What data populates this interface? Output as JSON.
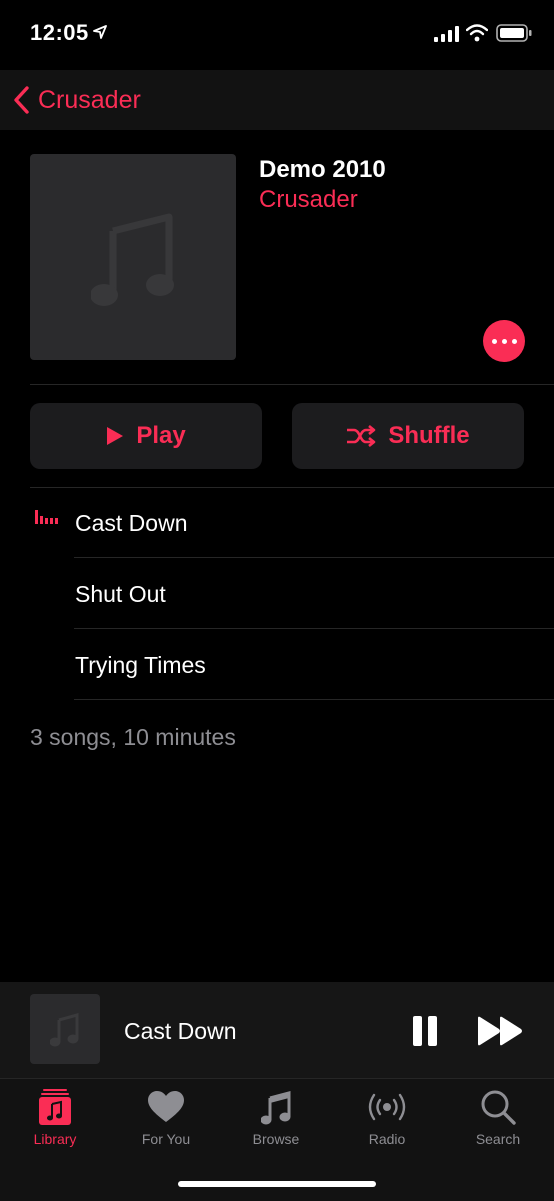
{
  "status": {
    "time": "12:05"
  },
  "nav": {
    "back_label": "Crusader"
  },
  "album": {
    "title": "Demo 2010",
    "artist": "Crusader",
    "play_label": "Play",
    "shuffle_label": "Shuffle",
    "summary": "3 songs, 10 minutes"
  },
  "tracks": [
    {
      "title": "Cast Down",
      "now_playing": true
    },
    {
      "title": "Shut Out",
      "now_playing": false
    },
    {
      "title": "Trying Times",
      "now_playing": false
    }
  ],
  "mini_player": {
    "title": "Cast Down"
  },
  "tabs": [
    {
      "label": "Library",
      "icon": "library-icon",
      "active": true
    },
    {
      "label": "For You",
      "icon": "heart-icon",
      "active": false
    },
    {
      "label": "Browse",
      "icon": "music-note-icon",
      "active": false
    },
    {
      "label": "Radio",
      "icon": "radio-icon",
      "active": false
    },
    {
      "label": "Search",
      "icon": "search-icon",
      "active": false
    }
  ],
  "colors": {
    "accent": "#fa2d55",
    "background": "#000000",
    "secondary_text": "#8e8e93"
  }
}
